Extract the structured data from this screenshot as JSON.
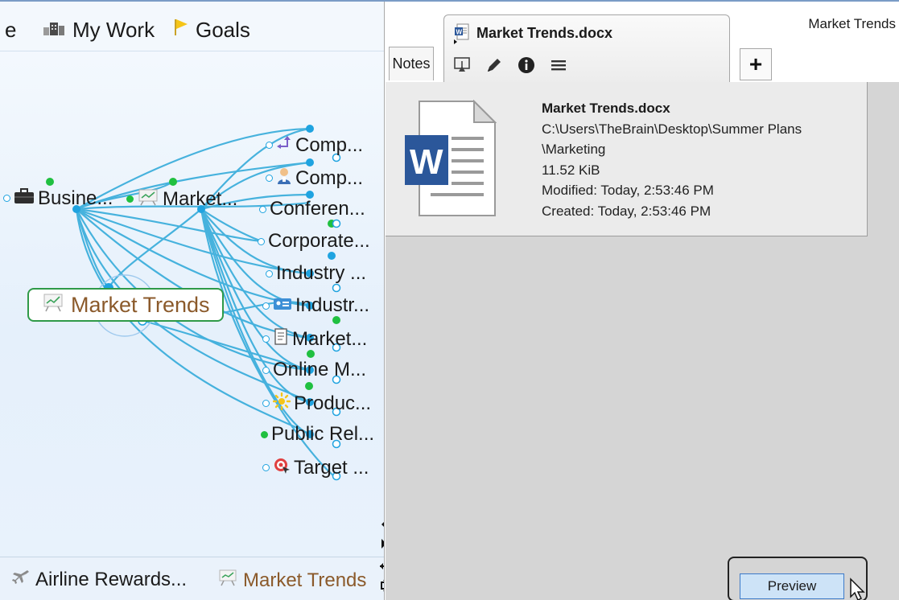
{
  "brain": {
    "pins": [
      {
        "label": "e",
        "icon": "partial-pin"
      },
      {
        "label": "My Work",
        "icon": "building-icon"
      },
      {
        "label": "Goals",
        "icon": "flag-icon"
      }
    ],
    "parents": [
      {
        "label": "Busine...",
        "icon": "briefcase-icon"
      },
      {
        "label": "Market...",
        "icon": "presentation-icon"
      }
    ],
    "active_thought": {
      "label": "Market Trends",
      "icon": "chart-board-icon"
    },
    "children": [
      {
        "label": "Comp...",
        "icon": "arrows-icon"
      },
      {
        "label": "Comp...",
        "icon": "person-icon"
      },
      {
        "label": "Conferen...",
        "icon": ""
      },
      {
        "label": "Corporate...",
        "icon": ""
      },
      {
        "label": "Industry ...",
        "icon": ""
      },
      {
        "label": "Industr...",
        "icon": "id-card-icon"
      },
      {
        "label": "Market...",
        "icon": "document-icon"
      },
      {
        "label": "Online M...",
        "icon": ""
      },
      {
        "label": "Produc...",
        "icon": "sun-icon"
      },
      {
        "label": "Public Rel...",
        "icon": ""
      },
      {
        "label": "Target ...",
        "icon": "target-icon"
      }
    ],
    "history": [
      {
        "label": "Airline Rewards...",
        "icon": "airplane-icon"
      },
      {
        "label": "Market Trends",
        "icon": "chart-board-icon",
        "color": "#8b5a2b"
      }
    ]
  },
  "panel": {
    "window_title": "Market Trends",
    "notes_tab": "Notes",
    "file_tab_title": "Market Trends.docx",
    "add_tab": "+",
    "tools": [
      "present-icon",
      "pencil-icon",
      "info-icon",
      "menu-icon"
    ],
    "file": {
      "name": "Market Trends.docx",
      "path_line1": "C:\\Users\\TheBrain\\Desktop\\Summer Plans",
      "path_line2": "\\Marketing",
      "size": "11.52 KiB",
      "modified": "Modified: Today, 2:53:46 PM",
      "created": "Created: Today, 2:53:46 PM"
    },
    "preview_button": "Preview"
  },
  "colors": {
    "link_blue": "#2aa7d8",
    "node_green": "#20c040",
    "active_border": "#2f9a48",
    "active_text": "#8b5a2b",
    "word_blue": "#2b579a"
  }
}
